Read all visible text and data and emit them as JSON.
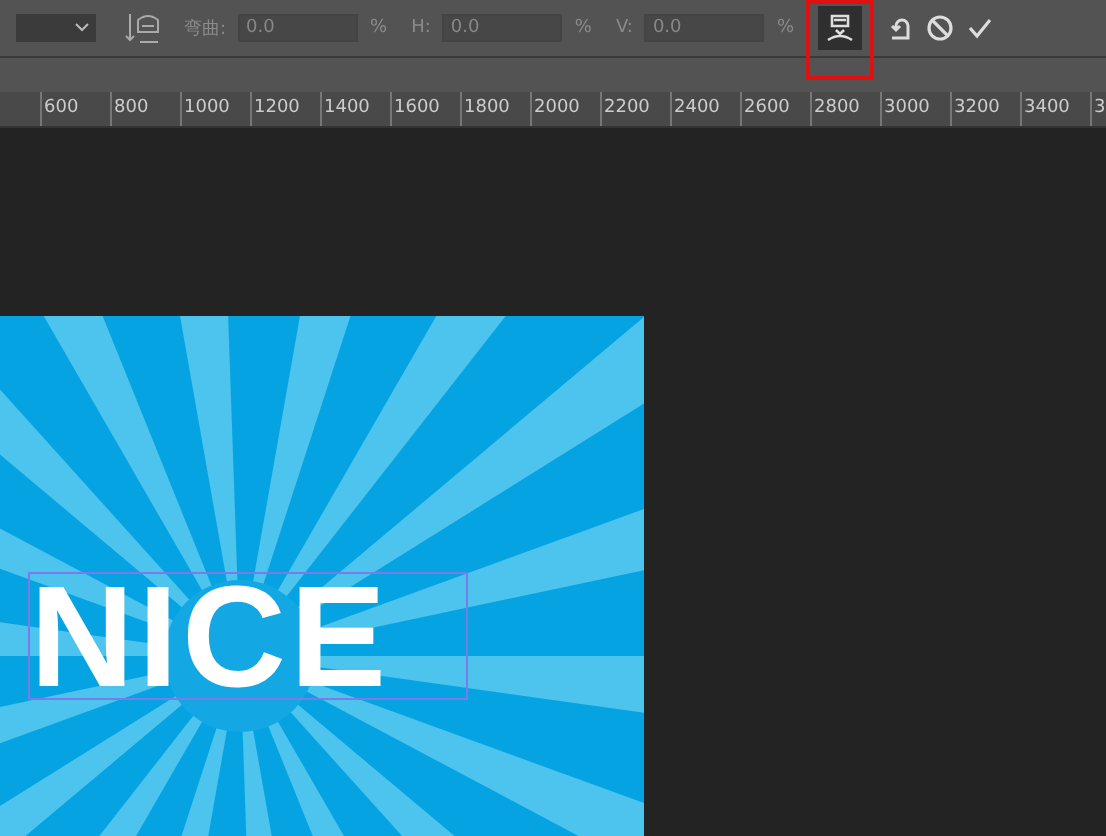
{
  "toolbar": {
    "fields": [
      {
        "label": "弯曲:",
        "value": "0.0",
        "unit": "%"
      },
      {
        "label": "H:",
        "value": "0.0",
        "unit": "%"
      },
      {
        "label": "V:",
        "value": "0.0",
        "unit": "%"
      }
    ],
    "mode_button": {
      "highlighted": true
    }
  },
  "ruler": {
    "labels": [
      "600",
      "800",
      "1000",
      "1200",
      "1400",
      "1600",
      "1800",
      "2000",
      "2200",
      "2400",
      "2600",
      "2800",
      "3000",
      "3200",
      "3400",
      "3"
    ]
  },
  "canvas": {
    "text": "NICE",
    "selected": true
  }
}
